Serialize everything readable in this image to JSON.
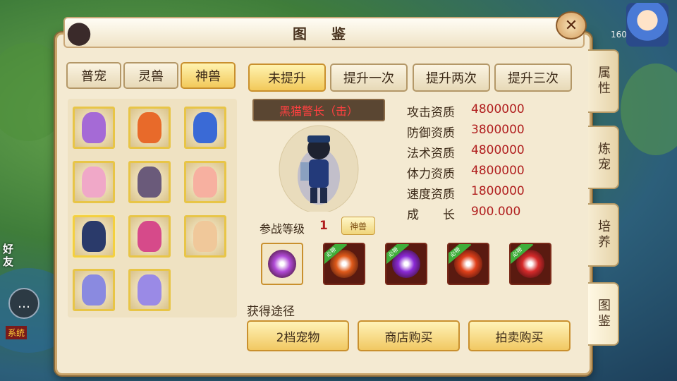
{
  "window": {
    "title": "图 鉴",
    "close_label": "✕"
  },
  "categories": [
    {
      "label": "普宠",
      "active": false
    },
    {
      "label": "灵兽",
      "active": false
    },
    {
      "label": "神兽",
      "active": true
    }
  ],
  "upgrade_tabs": [
    {
      "label": "未提升",
      "active": true
    },
    {
      "label": "提升一次",
      "active": false
    },
    {
      "label": "提升两次",
      "active": false
    },
    {
      "label": "提升三次",
      "active": false
    }
  ],
  "pets": [
    {
      "color": "#a56ad6",
      "selected": false
    },
    {
      "color": "#e86a2a",
      "selected": false
    },
    {
      "color": "#3a6ad6",
      "selected": false
    },
    {
      "color": "#f0a8c8",
      "selected": false
    },
    {
      "color": "#6a5a7a",
      "selected": false
    },
    {
      "color": "#f7b0a0",
      "selected": false
    },
    {
      "color": "#2a3a6a",
      "selected": true
    },
    {
      "color": "#d64a8a",
      "selected": false
    },
    {
      "color": "#f0c89a",
      "selected": false
    },
    {
      "color": "#8a8ae0",
      "selected": false
    },
    {
      "color": "#9a8ae6",
      "selected": false
    }
  ],
  "pet_name": "黑猫警长（击）",
  "stats": [
    {
      "label": "攻击资质",
      "value": "4800000"
    },
    {
      "label": "防御资质",
      "value": "3800000"
    },
    {
      "label": "法术资质",
      "value": "4800000"
    },
    {
      "label": "体力资质",
      "value": "4800000"
    },
    {
      "label": "速度资质",
      "value": "1800000"
    },
    {
      "label": "成　　长",
      "value": "900.000"
    }
  ],
  "battle_level": {
    "label": "参战等级",
    "value": "1",
    "badge": "神兽"
  },
  "skills": [
    {
      "name": "skill-vortex-icon",
      "color": "#b04ad6",
      "ribbon": ""
    },
    {
      "name": "skill-lightning-icon",
      "color": "#e05a1a",
      "ribbon": "必带"
    },
    {
      "name": "skill-shadow-icon",
      "color": "#8a2ad6",
      "ribbon": "必带"
    },
    {
      "name": "skill-fire-orb-icon",
      "color": "#e0401a",
      "ribbon": "必带"
    },
    {
      "name": "skill-heart-icon",
      "color": "#d62a2a",
      "ribbon": "必带"
    }
  ],
  "acquire": {
    "label": "获得途径",
    "buttons": [
      "2档宠物",
      "商店购买",
      "拍卖购买"
    ]
  },
  "side_tabs": [
    {
      "label": "属性",
      "active": false
    },
    {
      "label": "炼宠",
      "active": false
    },
    {
      "label": "培养",
      "active": false
    },
    {
      "label": "图鉴",
      "active": true
    }
  ],
  "hud": {
    "friend_label": "好友",
    "system_label": "系统",
    "level_readout": "160"
  }
}
